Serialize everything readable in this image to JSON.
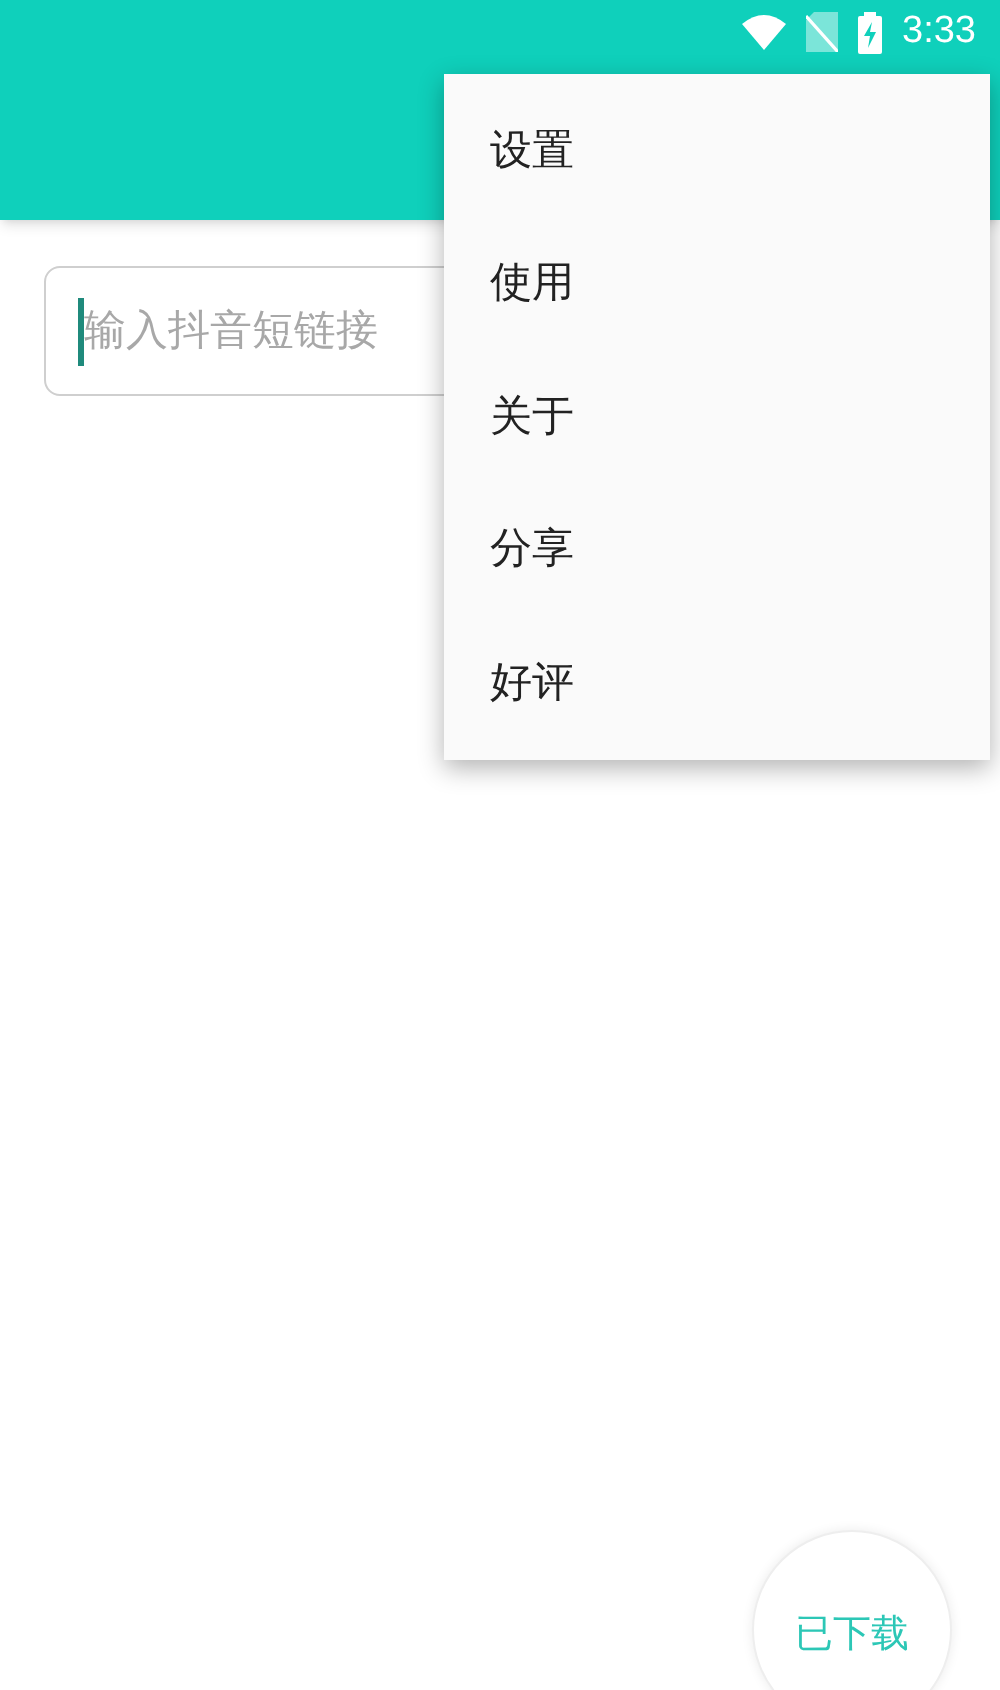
{
  "status_bar": {
    "time": "3:33"
  },
  "url_field": {
    "placeholder": "输入抖音短链接",
    "focused": true
  },
  "menu": {
    "items": [
      {
        "label": "设置"
      },
      {
        "label": "使用"
      },
      {
        "label": "关于"
      },
      {
        "label": "分享"
      },
      {
        "label": "好评"
      }
    ]
  },
  "downloaded_button": {
    "label": "已下载"
  }
}
